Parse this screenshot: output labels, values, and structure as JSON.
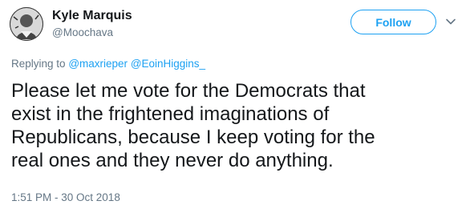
{
  "author": {
    "display_name": "Kyle Marquis",
    "handle": "@Moochava"
  },
  "header": {
    "follow_label": "Follow"
  },
  "reply": {
    "prefix": "Replying to",
    "mentions": [
      "@maxrieper",
      "@EoinHiggins_"
    ]
  },
  "tweet": {
    "lines": [
      "Please let me vote for the Democrats that",
      "exist in the frightened imaginations of",
      "Republicans, because I keep voting for the",
      "real ones and they never do anything."
    ],
    "timestamp": "1:51 PM - 30 Oct 2018"
  },
  "colors": {
    "accent": "#1da1f2",
    "secondary_text": "#657786",
    "primary_text": "#14171a"
  },
  "icons": {
    "caret": "chevron-down-icon"
  }
}
